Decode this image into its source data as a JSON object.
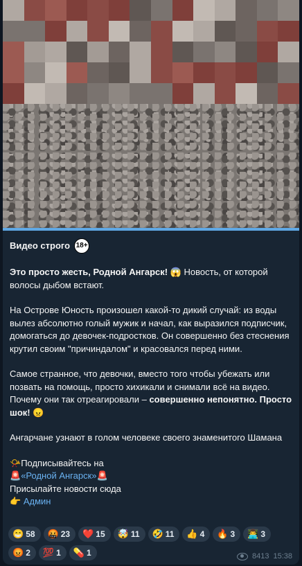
{
  "post": {
    "channel_title": "Видео строго",
    "age_badge": "18+",
    "video_progress_percent": 100,
    "headline_bold": "Это просто жесть, Родной Ангарск!",
    "headline_emoji": "😱",
    "headline_rest": " Новость, от которой волосы дыбом встают.",
    "para1": "На Острове Юность произошел какой-то дикий случай: из воды вылез абсолютно голый мужик и начал, как выразился подписчик, домогаться до девочек-подростков. Он совершенно без стеснения крутил своим \"причиндалом\" и красовался перед ними.",
    "para2_text": "Самое странное, что девочки, вместо того чтобы убежать или позвать на помощь, просто хихикали и снимали всё на видео. Почему они так отреагировали – ",
    "para2_bold": "совершенно непонятно. Просто шок!",
    "para2_emoji": "😠",
    "para3": "Ангарчане узнают в голом человеке своего знаменитого Шамана",
    "subscribe_emoji": "📯",
    "subscribe_text": "Подписывайтесь на",
    "link_left_emoji": "🚨",
    "link_text": "«Родной Ангарск»",
    "link_right_emoji": "🚨",
    "send_news": "Присылайте новости сюда",
    "admin_emoji": "👉",
    "admin_link": "Админ"
  },
  "reactions_row1": [
    {
      "emoji": "😁",
      "count": "58"
    },
    {
      "emoji": "🤬",
      "count": "23"
    },
    {
      "emoji": "❤️",
      "count": "15"
    },
    {
      "emoji": "🤯",
      "count": "11"
    },
    {
      "emoji": "🤣",
      "count": "11"
    },
    {
      "emoji": "👍",
      "count": "4"
    },
    {
      "emoji": "🔥",
      "count": "3"
    },
    {
      "emoji": "👨‍💻",
      "count": "3"
    }
  ],
  "reactions_row2": [
    {
      "emoji": "😡",
      "count": "2"
    },
    {
      "emoji": "💯",
      "count": "1"
    },
    {
      "emoji": "💊",
      "count": "1"
    }
  ],
  "meta": {
    "views": "8413",
    "time": "15:38"
  }
}
